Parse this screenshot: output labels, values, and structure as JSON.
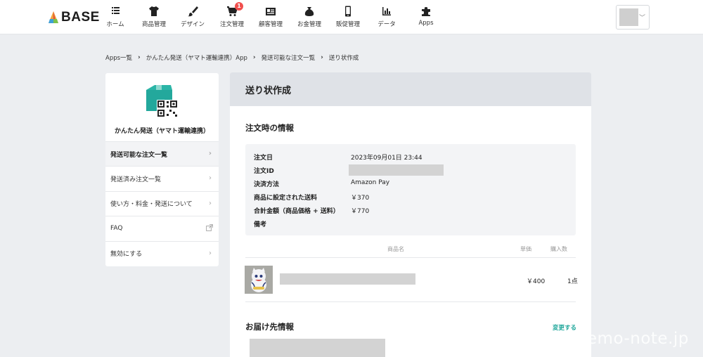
{
  "brand": {
    "name": "BASE"
  },
  "nav": {
    "items": [
      {
        "label": "ホーム",
        "icon": "list-icon"
      },
      {
        "label": "商品管理",
        "icon": "tshirt-icon"
      },
      {
        "label": "デザイン",
        "icon": "brush-icon"
      },
      {
        "label": "注文管理",
        "icon": "cart-icon",
        "badge": "1"
      },
      {
        "label": "顧客管理",
        "icon": "contact-card-icon"
      },
      {
        "label": "お金管理",
        "icon": "money-bag-icon"
      },
      {
        "label": "販促管理",
        "icon": "smartphone-icon"
      },
      {
        "label": "データ",
        "icon": "bar-chart-icon"
      },
      {
        "label": "Apps",
        "icon": "puzzle-icon"
      }
    ]
  },
  "breadcrumb": [
    "Apps一覧",
    "かんたん発送（ヤマト運輸連携）App",
    "発送可能な注文一覧",
    "送り状作成"
  ],
  "sidebar": {
    "app_name": "かんたん発送（ヤマト運輸連携）",
    "items": [
      {
        "label": "発送可能な注文一覧",
        "active": true
      },
      {
        "label": "発送済み注文一覧"
      },
      {
        "label": "使い方・料金・発送について"
      },
      {
        "label": "FAQ",
        "external": true
      },
      {
        "label": "無効にする"
      }
    ]
  },
  "main": {
    "title": "送り状作成",
    "order_section_title": "注文時の情報",
    "order_info": [
      {
        "key": "注文日",
        "value": "2023年09月01日 23:44"
      },
      {
        "key": "注文ID",
        "value": ""
      },
      {
        "key": "決済方法",
        "value": "Amazon Pay"
      },
      {
        "key": "商品に設定された送料",
        "value": "￥370"
      },
      {
        "key": "合計金額（商品価格 + 送料）",
        "value": "￥770"
      },
      {
        "key": "備考",
        "value": ""
      }
    ],
    "product_table": {
      "headers": {
        "name": "商品名",
        "price": "単価",
        "qty": "購入数"
      },
      "rows": [
        {
          "name": "",
          "price": "￥400",
          "qty": "1点"
        }
      ]
    },
    "delivery_section_title": "お届け先情報",
    "change_link": "変更する"
  },
  "watermark": "memo-note.jp",
  "colors": {
    "accent": "#23a89c",
    "badge": "#f1504e",
    "header_band": "#dfe2e7",
    "page_bg": "#eceef1"
  }
}
